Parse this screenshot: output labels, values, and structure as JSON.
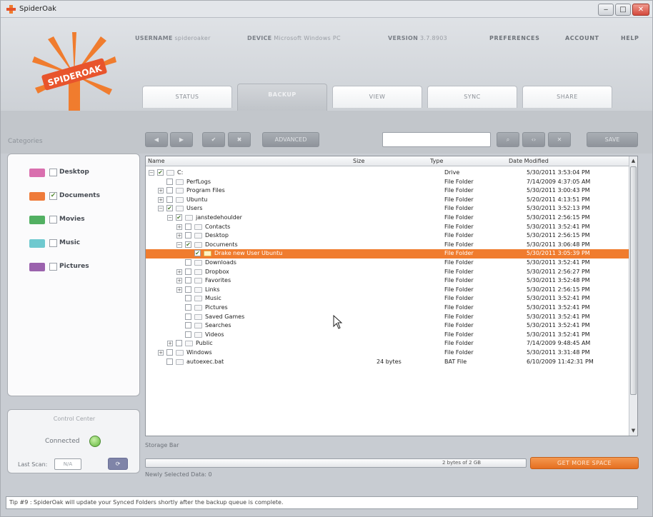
{
  "window": {
    "title": "SpiderOak",
    "buttons": [
      "‒",
      "□",
      "✕"
    ]
  },
  "header": {
    "logo_text": "SPIDEROAK",
    "meta": [
      {
        "label": "USERNAME",
        "value": "spideroaker"
      },
      {
        "label": "DEVICE",
        "value": "Microsoft Windows PC"
      },
      {
        "label": "VERSION",
        "value": "3.7.8903"
      }
    ],
    "links": [
      "PREFERENCES",
      "ACCOUNT",
      "HELP"
    ],
    "tabs": [
      "STATUS",
      "BACKUP",
      "VIEW",
      "SYNC",
      "SHARE"
    ],
    "active_tab": 1
  },
  "toolbar": {
    "buttons": [
      "◀",
      "▶",
      "✔",
      "✖",
      "ADVANCED"
    ],
    "search_placeholder": "",
    "right_buttons": [
      "⌕",
      "‹›",
      "✕",
      "SAVE"
    ]
  },
  "categories": {
    "label": "Categories",
    "items": [
      {
        "name": "Desktop",
        "color": "#d96fae",
        "checked": false
      },
      {
        "name": "Documents",
        "color": "#ef7b3a",
        "checked": true
      },
      {
        "name": "Movies",
        "color": "#52b062",
        "checked": false
      },
      {
        "name": "Music",
        "color": "#6fc9cf",
        "checked": false
      },
      {
        "name": "Pictures",
        "color": "#9b62ad",
        "checked": false
      }
    ]
  },
  "control_center": {
    "title": "Control Center",
    "connected": "Connected",
    "last_scan_label": "Last Scan:",
    "last_scan_value": "N/A",
    "scan_button": "⟳"
  },
  "tree": {
    "columns": {
      "name": "Name",
      "size": "Size",
      "type": "Type",
      "date": "Date Modified"
    },
    "rows": [
      {
        "indent": 0,
        "exp": "−",
        "check": "✔",
        "name": "C:",
        "type": "Drive",
        "date": "5/30/2011 3:53:04 PM"
      },
      {
        "indent": 1,
        "exp": "",
        "check": "",
        "name": "PerfLogs",
        "type": "File Folder",
        "date": "7/14/2009 4:37:05 AM"
      },
      {
        "indent": 1,
        "exp": "+",
        "check": "",
        "name": "Program Files",
        "type": "File Folder",
        "date": "5/30/2011 3:00:43 PM"
      },
      {
        "indent": 1,
        "exp": "+",
        "check": "",
        "name": "Ubuntu",
        "type": "File Folder",
        "date": "5/20/2011 4:13:51 PM"
      },
      {
        "indent": 1,
        "exp": "−",
        "check": "✔",
        "name": "Users",
        "type": "File Folder",
        "date": "5/30/2011 3:52:13 PM"
      },
      {
        "indent": 2,
        "exp": "−",
        "check": "✔",
        "name": "janstedehoulder",
        "type": "File Folder",
        "date": "5/30/2011 2:56:15 PM"
      },
      {
        "indent": 3,
        "exp": "+",
        "check": "",
        "name": "Contacts",
        "type": "File Folder",
        "date": "5/30/2011 3:52:41 PM"
      },
      {
        "indent": 3,
        "exp": "+",
        "check": "",
        "name": "Desktop",
        "type": "File Folder",
        "date": "5/30/2011 2:56:15 PM"
      },
      {
        "indent": 3,
        "exp": "−",
        "check": "✔",
        "name": "Documents",
        "type": "File Folder",
        "date": "5/30/2011 3:06:48 PM"
      },
      {
        "indent": 4,
        "exp": "",
        "check": "✔",
        "name": "Drake new User Ubuntu",
        "type": "File Folder",
        "date": "5/30/2011 3:05:39 PM",
        "selected": true
      },
      {
        "indent": 3,
        "exp": "",
        "check": "",
        "name": "Downloads",
        "type": "File Folder",
        "date": "5/30/2011 3:52:41 PM"
      },
      {
        "indent": 3,
        "exp": "+",
        "check": "",
        "name": "Dropbox",
        "type": "File Folder",
        "date": "5/30/2011 2:56:27 PM"
      },
      {
        "indent": 3,
        "exp": "+",
        "check": "",
        "name": "Favorites",
        "type": "File Folder",
        "date": "5/30/2011 3:52:48 PM"
      },
      {
        "indent": 3,
        "exp": "+",
        "check": "",
        "name": "Links",
        "type": "File Folder",
        "date": "5/30/2011 2:56:15 PM"
      },
      {
        "indent": 3,
        "exp": "",
        "check": "",
        "name": "Music",
        "type": "File Folder",
        "date": "5/30/2011 3:52:41 PM"
      },
      {
        "indent": 3,
        "exp": "",
        "check": "",
        "name": "Pictures",
        "type": "File Folder",
        "date": "5/30/2011 3:52:41 PM"
      },
      {
        "indent": 3,
        "exp": "",
        "check": "",
        "name": "Saved Games",
        "type": "File Folder",
        "date": "5/30/2011 3:52:41 PM"
      },
      {
        "indent": 3,
        "exp": "",
        "check": "",
        "name": "Searches",
        "type": "File Folder",
        "date": "5/30/2011 3:52:41 PM"
      },
      {
        "indent": 3,
        "exp": "",
        "check": "",
        "name": "Videos",
        "type": "File Folder",
        "date": "5/30/2011 3:52:41 PM"
      },
      {
        "indent": 2,
        "exp": "+",
        "check": "",
        "name": "Public",
        "type": "File Folder",
        "date": "7/14/2009 9:48:45 AM"
      },
      {
        "indent": 1,
        "exp": "+",
        "check": "",
        "name": "Windows",
        "type": "File Folder",
        "date": "5/30/2011 3:31:48 PM"
      },
      {
        "indent": 1,
        "exp": "",
        "check": "",
        "name": "autoexec.bat",
        "size": "24 bytes",
        "type": "BAT File",
        "date": "6/10/2009 11:42:31 PM"
      }
    ]
  },
  "storage": {
    "label": "Storage Bar",
    "value": "2 bytes of 2 GB",
    "more_button": "GET MORE SPACE",
    "newly_selected": "Newly Selected Data: 0"
  },
  "status": {
    "tip": "Tip #9 : SpiderOak will update your Synced Folders shortly after the backup queue is complete."
  }
}
